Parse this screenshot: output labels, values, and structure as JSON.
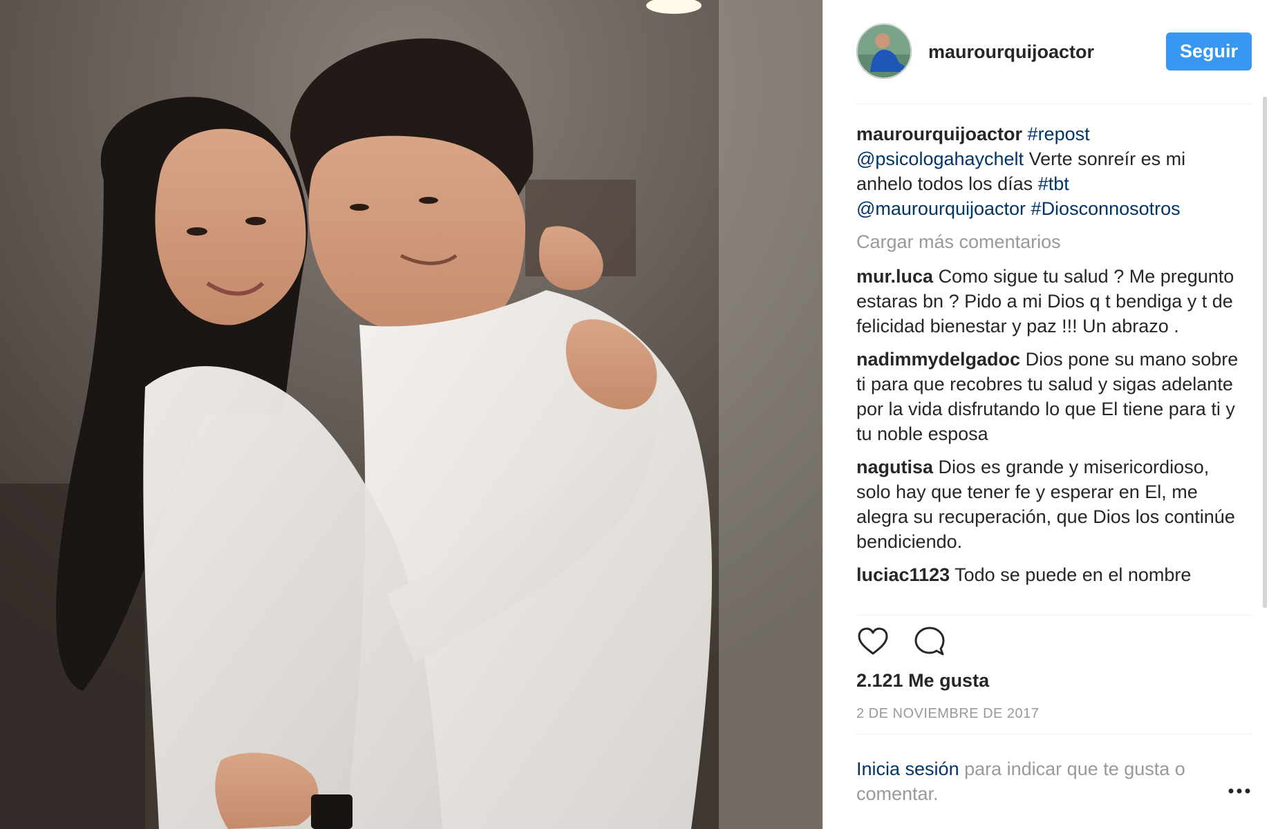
{
  "post": {
    "username": "maurourquijoactor",
    "follow_label": "Seguir"
  },
  "caption": {
    "username": "maurourquijoactor",
    "hashtag_repost": "#repost",
    "mention_1": "@psicologahaychelt",
    "text_1": " Verte sonreír es mi anhelo todos los días ",
    "hashtag_tbt": "#tbt",
    "mention_2": "@maurourquijoactor",
    "hashtag_dios": "#Diosconnosotros"
  },
  "load_more": "Cargar más comentarios",
  "comments": [
    {
      "user": "mur.luca",
      "text": "Como sigue tu salud ? Me pregunto estaras bn ? Pido a mi Dios q t bendiga y t de felicidad bienestar y paz !!! Un abrazo ."
    },
    {
      "user": "nadimmydelgadoc",
      "text": "Dios pone su mano sobre ti para que recobres tu salud y sigas adelante por la vida disfrutando lo que El tiene para ti y tu noble esposa"
    },
    {
      "user": "nagutisa",
      "text": "Dios es grande y misericordioso, solo hay que tener fe y esperar en El, me alegra su recuperación, que Dios los continúe bendiciendo."
    },
    {
      "user": "luciac1123",
      "text": "Todo se puede en el nombre"
    }
  ],
  "likes": "2.121 Me gusta",
  "date": "2 DE NOVIEMBRE DE 2017",
  "login": {
    "link": "Inicia sesión",
    "text": " para indicar que te gusta o comentar."
  },
  "icons": {
    "like": "heart-icon",
    "comment": "comment-icon",
    "more": "more-options-icon"
  },
  "colors": {
    "accent": "#3897f0",
    "link": "#003569",
    "muted": "#999999"
  }
}
